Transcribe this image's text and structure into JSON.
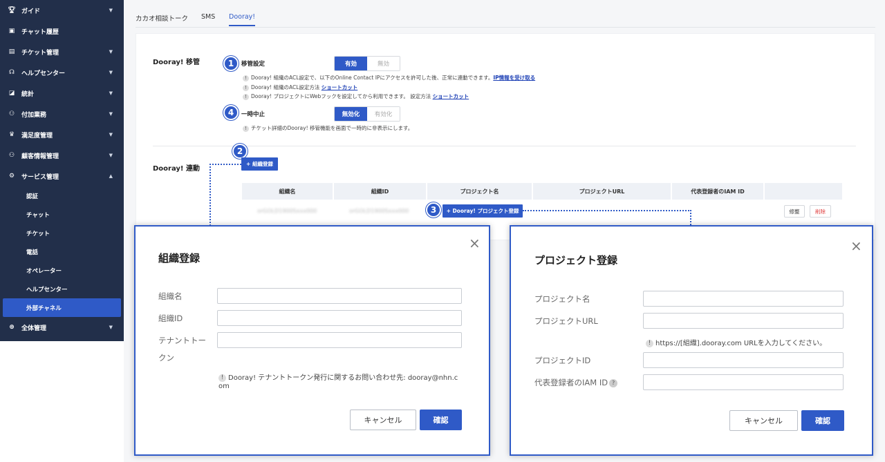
{
  "sidebar": {
    "items": [
      {
        "label": "ガイド",
        "icon": "trophy-icon",
        "chevron": "▼"
      },
      {
        "label": "チャット履歴",
        "icon": "chat-icon",
        "chevron": ""
      },
      {
        "label": "チケット管理",
        "icon": "ticket-icon",
        "chevron": "▼"
      },
      {
        "label": "ヘルプセンター",
        "icon": "headset-icon",
        "chevron": "▼"
      },
      {
        "label": "統計",
        "icon": "chart-icon",
        "chevron": "▼"
      },
      {
        "label": "付加業務",
        "icon": "person-icon",
        "chevron": "▼"
      },
      {
        "label": "満足度管理",
        "icon": "thumbs-up-icon",
        "chevron": "▼"
      },
      {
        "label": "顧客情報管理",
        "icon": "customer-icon",
        "chevron": "▼"
      },
      {
        "label": "サービス管理",
        "icon": "gear-icon",
        "chevron": "▲"
      }
    ],
    "sub_items": [
      "認証",
      "チャット",
      "チケット",
      "電話",
      "オペレーター",
      "ヘルプセンター",
      "外部チャネル"
    ],
    "bottom_item": {
      "label": "全体管理",
      "icon": "plus-circle-icon",
      "chevron": "▼"
    }
  },
  "tabs": [
    "カカオ相談トーク",
    "SMS",
    "Dooray!"
  ],
  "transfer": {
    "title": "Dooray! 移管",
    "setting_label": "移管設定",
    "toggle_on": "有効",
    "toggle_off": "無効",
    "note1": "Dooray! 組織のACL設定で、以下のOnline Contact IPにアクセスを許可した後、正常に連動できます。",
    "note1_link": "IP情報を受け取る",
    "note2": "Dooray! 組織のACL設定方法",
    "note2_link": "ショートカット",
    "note3": "Dooray! プロジェクトにWebフックを設定してから利用できます。 設定方法",
    "note3_link": "ショートカット",
    "pause_label": "一時中止",
    "pause_on": "無効化",
    "pause_off": "有効化",
    "pause_note": "チケット詳細のDooray! 移管機能を画面で一時的に非表示にします。"
  },
  "link": {
    "title": "Dooray! 連動",
    "add_org_button": "+ 組織登録",
    "columns": [
      "組織名",
      "組織ID",
      "プロジェクト名",
      "プロジェクトURL",
      "代表登録者のIAM ID",
      ""
    ],
    "row": {
      "org_name": "orGOLD1900Sxxx000",
      "org_id": "orGOLD1900Sxxx000",
      "add_project_button": "+ Dooray! プロジェクト登録",
      "edit": "修整",
      "delete": "削除"
    }
  },
  "badges": [
    "1",
    "2",
    "3",
    "4"
  ],
  "org_modal": {
    "title": "組織登録",
    "close": "×",
    "label_name": "組織名",
    "label_id": "組織ID",
    "label_token": "テナントトー",
    "label_token2": "クン",
    "note_line1": "Dooray! テナントトークン発行に関するお問い合わせ先: dooray@nhn.c",
    "note_line2": "om",
    "cancel": "キャンセル",
    "confirm": "確認"
  },
  "project_modal": {
    "title": "プロジェクト登録",
    "close": "×",
    "label_name": "プロジェクト名",
    "label_url": "プロジェクトURL",
    "url_note": "https://[組織].dooray.com URLを入力してください。",
    "label_id": "プロジェクトID",
    "label_iam": "代表登録者のIAM ID",
    "cancel": "キャンセル",
    "confirm": "確認"
  },
  "colors": {
    "sidebar_bg": "#222f4a",
    "accent": "#2f5ac7",
    "delete_red": "#e03c3c"
  }
}
